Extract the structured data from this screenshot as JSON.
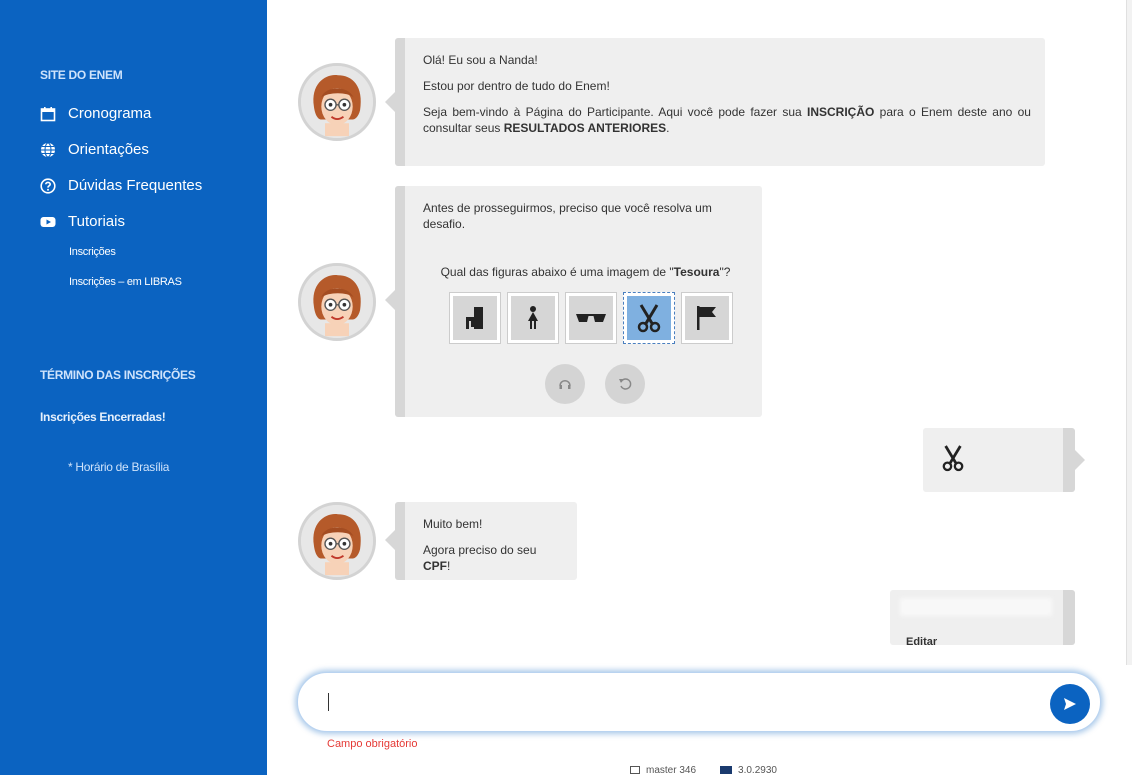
{
  "sidebar": {
    "title": "SITE DO ENEM",
    "items": [
      {
        "label": "Cronograma",
        "icon": "calendar-icon"
      },
      {
        "label": "Orientações",
        "icon": "globe-icon"
      },
      {
        "label": "Dúvidas Frequentes",
        "icon": "question-circle-icon"
      },
      {
        "label": "Tutoriais",
        "icon": "youtube-icon"
      }
    ],
    "subitems": [
      "Inscrições",
      "Inscrições – em LIBRAS"
    ],
    "section_title": "TÉRMINO DAS INSCRIÇÕES",
    "closed_text": "Inscrições Encerradas!",
    "note": "* Horário de Brasília"
  },
  "chat": {
    "msg1": {
      "line1": "Olá! Eu sou a Nanda!",
      "line2": "Estou por dentro de tudo do Enem!",
      "line3_a": "Seja bem-vindo à Página do Participante. Aqui você pode fazer sua ",
      "line3_b": "INSCRIÇÃO",
      "line3_c": " para o Enem deste ano ou consultar seus ",
      "line3_d": "RESULTADOS ANTERIORES",
      "line3_e": "."
    },
    "msg2": {
      "intro": "Antes de prosseguirmos, preciso que você resolva um desafio.",
      "question_a": "Qual das figuras abaixo é uma imagem de \"",
      "question_b": "Tesoura",
      "question_c": "\"?",
      "options": [
        "chair-icon",
        "woman-icon",
        "sunglasses-icon",
        "scissors-icon",
        "flag-icon"
      ],
      "selected": "scissors-icon"
    },
    "reply1_icon": "scissors-icon",
    "msg3": {
      "line1": "Muito bem!",
      "line2_a": "Agora preciso do seu ",
      "line2_b": "CPF",
      "line2_c": "!"
    },
    "reply2_edit": "Editar"
  },
  "input": {
    "value": "",
    "placeholder": "",
    "required_text": "Campo obrigatório"
  },
  "footer": {
    "branch": "master 346",
    "version": "3.0.2930"
  },
  "colors": {
    "sidebar_bg": "#0b63c1",
    "bubble_bg": "#efefef",
    "accent": "#0b63c1",
    "error": "#e53935"
  }
}
